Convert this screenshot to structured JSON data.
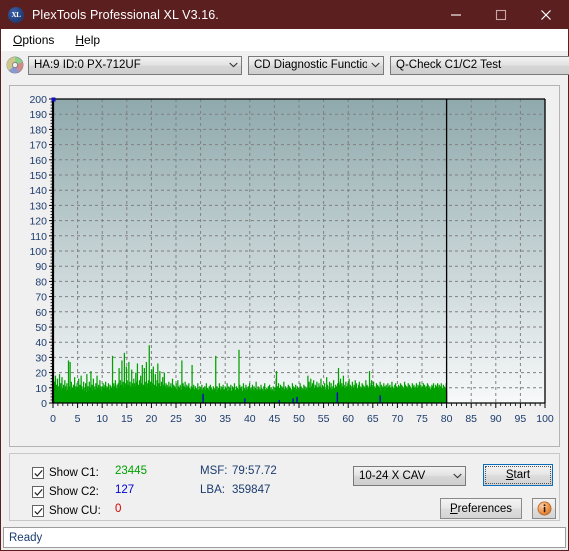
{
  "window": {
    "title": "PlexTools Professional XL V3.16.",
    "icon": "xl-app-icon",
    "icon_text": "XL",
    "titlebar_color": "#5c1f1f",
    "minimize": "minimize-icon",
    "maximize": "maximize-icon",
    "close": "close-icon"
  },
  "menu": {
    "items": [
      {
        "label": "Options",
        "mnemonic": "O"
      },
      {
        "label": "Help",
        "mnemonic": "H"
      }
    ]
  },
  "toolbar": {
    "disc_icon": "cd-disc-icon",
    "drive": {
      "value": "HA:9 ID:0  PX-712UF"
    },
    "function": {
      "value": "CD Diagnostic Functions"
    },
    "test": {
      "value": "Q-Check C1/C2 Test"
    }
  },
  "legend": {
    "c1": {
      "label": "Show C1:",
      "value": "23445",
      "color": "#00a000",
      "checked": true
    },
    "c2": {
      "label": "Show C2:",
      "value": "127",
      "color": "#0000d0",
      "checked": true
    },
    "cu": {
      "label": "Show CU:",
      "value": "0",
      "color": "#d00000",
      "checked": true
    }
  },
  "position": {
    "msf_label": "MSF:",
    "msf_value": "79:57.72",
    "lba_label": "LBA:",
    "lba_value": "359847"
  },
  "controls": {
    "speed": {
      "value": "10-24 X CAV"
    },
    "start": {
      "label": "Start",
      "mnemonic": "S",
      "focused": true
    },
    "preferences": {
      "label": "Preferences",
      "mnemonic": "P"
    },
    "info": {
      "icon": "info-icon"
    }
  },
  "statusbar": {
    "text": "Ready"
  },
  "chart_data": {
    "type": "area",
    "title": "",
    "xlabel": "",
    "ylabel": "",
    "xlim": [
      0,
      100
    ],
    "ylim": [
      0,
      200
    ],
    "xticks": [
      0,
      5,
      10,
      15,
      20,
      25,
      30,
      35,
      40,
      45,
      50,
      55,
      60,
      65,
      70,
      75,
      80,
      85,
      90,
      95,
      100
    ],
    "yticks": [
      0,
      10,
      20,
      30,
      40,
      50,
      60,
      70,
      80,
      90,
      100,
      110,
      120,
      130,
      140,
      150,
      160,
      170,
      180,
      190,
      200
    ],
    "grid": true,
    "legend_position": "below-plot",
    "plot_bg_top": "#8fa9ac",
    "plot_bg_bottom": "#f7f9fa",
    "data_end_x": 80,
    "marker": {
      "x": 0,
      "y": 200,
      "color": "#1010c0"
    },
    "series": [
      {
        "name": "C1",
        "color": "#00a000",
        "x_step": 0.08,
        "values": [
          8,
          21,
          6,
          10,
          14,
          7,
          18,
          5,
          9,
          12,
          6,
          16,
          8,
          5,
          11,
          7,
          19,
          9,
          6,
          13,
          5,
          8,
          17,
          6,
          10,
          7,
          12,
          5,
          9,
          15,
          6,
          11,
          8,
          5,
          13,
          7,
          9,
          6,
          28,
          11,
          5,
          8,
          27,
          6,
          9,
          14,
          7,
          5,
          10,
          6,
          12,
          8,
          5,
          17,
          6,
          9,
          11,
          5,
          8,
          13,
          6,
          10,
          7,
          16,
          5,
          9,
          12,
          6,
          8,
          18,
          5,
          11,
          7,
          9,
          6,
          14,
          5,
          8,
          10,
          6,
          13,
          7,
          5,
          19,
          9,
          6,
          11,
          8,
          5,
          14,
          7,
          10,
          6,
          21,
          5,
          9,
          12,
          6,
          8,
          16,
          5,
          11,
          7,
          9,
          6,
          13,
          5,
          8,
          18,
          6,
          10,
          7,
          12,
          5,
          9,
          15,
          6,
          11,
          8,
          5,
          9,
          11,
          7,
          13,
          6,
          10,
          8,
          12,
          5,
          14,
          7,
          9,
          11,
          6,
          10,
          8,
          13,
          5,
          9,
          7,
          12,
          6,
          11,
          8,
          10,
          5,
          31,
          9,
          7,
          13,
          6,
          11,
          8,
          15,
          5,
          10,
          7,
          12,
          6,
          9,
          13,
          8,
          23,
          10,
          6,
          15,
          9,
          12,
          7,
          28,
          11,
          8,
          14,
          6,
          10,
          33,
          9,
          13,
          7,
          11,
          24,
          8,
          15,
          6,
          12,
          9,
          27,
          10,
          7,
          14,
          8,
          11,
          6,
          22,
          9,
          13,
          7,
          10,
          16,
          9,
          13,
          7,
          11,
          20,
          8,
          14,
          6,
          26,
          10,
          9,
          12,
          7,
          15,
          8,
          11,
          18,
          6,
          13,
          9,
          25,
          10,
          7,
          12,
          8,
          23,
          9,
          14,
          6,
          11,
          27,
          8,
          13,
          10,
          7,
          15,
          9,
          38,
          12,
          6,
          14,
          8,
          11,
          22,
          9,
          13,
          7,
          24,
          10,
          8,
          12,
          6,
          19,
          9,
          11,
          7,
          15,
          8,
          26,
          10,
          6,
          13,
          9,
          21,
          7,
          11,
          8,
          14,
          6,
          10,
          17,
          9,
          12,
          7,
          20,
          8,
          11,
          6,
          13,
          9,
          7,
          12,
          6,
          10,
          8,
          14,
          5,
          9,
          11,
          7,
          13,
          6,
          10,
          8,
          16,
          5,
          9,
          12,
          7,
          11,
          6,
          10,
          8,
          13,
          5,
          9,
          7,
          15,
          6,
          11,
          8,
          10,
          5,
          12,
          7,
          9,
          6,
          28,
          10,
          8,
          13,
          7,
          11,
          6,
          9,
          14,
          8,
          10,
          5,
          12,
          7,
          9,
          11,
          6,
          13,
          8,
          10,
          7,
          9,
          6,
          11,
          5,
          25,
          8,
          10,
          7,
          12,
          6,
          9,
          8,
          11,
          5,
          10,
          7,
          9,
          6,
          13,
          8,
          5,
          9,
          7,
          11,
          6,
          10,
          8,
          5,
          12,
          7,
          9,
          6,
          10,
          8,
          5,
          11,
          7,
          9,
          6,
          13,
          8,
          5,
          10,
          7,
          9,
          6,
          11,
          8,
          5,
          12,
          7,
          10,
          6,
          9,
          8,
          5,
          11,
          7,
          10,
          6,
          9,
          8,
          31,
          7,
          5,
          11,
          6,
          9,
          8,
          10,
          5,
          13,
          7,
          9,
          6,
          11,
          8,
          5,
          10,
          7,
          12,
          6,
          9,
          8,
          5,
          11,
          7,
          10,
          6,
          9,
          13,
          5,
          8,
          7,
          11,
          6,
          9,
          10,
          5,
          12,
          7,
          8,
          6,
          11,
          9,
          5,
          10,
          7,
          13,
          6,
          8,
          9,
          5,
          11,
          7,
          10,
          6,
          9,
          8,
          35,
          5,
          12,
          7,
          10,
          6,
          9,
          11,
          5,
          8,
          7,
          13,
          6,
          10,
          9,
          5,
          8,
          12,
          6,
          10,
          7,
          9,
          5,
          11,
          8,
          6,
          13,
          7,
          9,
          5,
          10,
          8,
          6,
          12,
          7,
          9,
          5,
          11,
          8,
          6,
          10,
          7,
          14,
          5,
          9,
          8,
          6,
          11,
          7,
          10,
          5,
          9,
          8,
          6,
          12,
          7,
          10,
          5,
          9,
          8,
          6,
          11,
          7,
          13,
          5,
          9,
          8,
          6,
          10,
          7,
          9,
          5,
          11,
          8,
          6,
          12,
          7,
          9,
          5,
          10,
          8,
          6,
          9,
          7,
          11,
          5,
          8,
          6,
          10,
          7,
          9,
          16,
          21,
          7,
          11,
          6,
          9,
          13,
          5,
          10,
          8,
          7,
          12,
          6,
          9,
          11,
          5,
          8,
          10,
          6,
          14,
          7,
          9,
          5,
          11,
          8,
          6,
          10,
          7,
          9,
          5,
          12,
          8,
          6,
          11,
          7,
          10,
          5,
          9,
          8,
          6,
          13,
          7,
          11,
          5,
          9,
          10,
          6,
          8,
          12,
          7,
          9,
          5,
          11,
          6,
          10,
          8,
          7,
          9,
          5,
          13,
          6,
          11,
          8,
          7,
          10,
          5,
          9,
          6,
          12,
          8,
          7,
          11,
          5,
          9,
          6,
          10,
          8,
          7,
          18,
          12,
          8,
          14,
          6,
          10,
          9,
          16,
          7,
          11,
          8,
          13,
          6,
          9,
          15,
          7,
          10,
          8,
          12,
          6,
          11,
          9,
          14,
          7,
          8,
          10,
          6,
          13,
          9,
          7,
          11,
          8,
          16,
          6,
          10,
          7,
          12,
          9,
          6,
          11,
          8,
          13,
          7,
          9,
          6,
          10,
          17,
          8,
          12,
          7,
          9,
          6,
          11,
          14,
          8,
          10,
          7,
          13,
          6,
          9,
          8,
          11,
          7,
          15,
          6,
          10,
          9,
          8,
          12,
          7,
          11,
          6,
          9,
          13,
          8,
          23,
          14,
          9,
          12,
          7,
          16,
          10,
          8,
          13,
          6,
          11,
          9,
          18,
          7,
          12,
          8,
          10,
          6,
          14,
          9,
          7,
          11,
          8,
          13,
          6,
          10,
          16,
          9,
          7,
          12,
          8,
          11,
          6,
          9,
          14,
          7,
          10,
          8,
          12,
          9,
          6,
          15,
          11,
          8,
          13,
          7,
          10,
          9,
          6,
          12,
          8,
          14,
          7,
          11,
          6,
          9,
          10,
          8,
          13,
          7,
          12,
          6,
          9,
          11,
          8,
          10,
          7,
          15,
          6,
          9,
          12,
          8,
          11,
          7,
          10,
          6,
          21,
          13,
          9,
          11,
          7,
          15,
          10,
          8,
          12,
          6,
          14,
          9,
          7,
          11,
          8,
          10,
          6,
          13,
          9,
          7,
          12,
          8,
          11,
          6,
          10,
          9,
          14,
          7,
          8,
          12,
          6,
          11,
          9,
          10,
          7,
          13,
          8,
          6,
          11,
          9,
          7,
          12,
          8,
          10,
          6,
          13,
          9,
          7,
          11,
          8,
          12,
          6,
          10,
          9,
          7,
          14,
          8,
          11,
          6,
          9,
          10,
          7,
          12,
          8,
          13,
          6,
          11,
          9,
          7,
          10,
          8,
          12,
          6,
          9,
          11,
          7,
          13,
          10,
          8,
          12,
          6,
          11,
          9,
          7,
          10,
          8,
          14,
          6,
          12,
          9,
          7,
          11,
          8,
          10,
          6,
          13,
          9,
          7,
          12,
          8,
          11,
          6,
          10,
          9,
          8,
          13,
          7,
          11,
          6,
          12,
          9,
          10,
          8,
          7,
          11,
          13,
          9,
          10,
          8,
          12,
          7,
          11,
          6,
          14,
          9,
          8,
          12,
          7,
          10,
          6,
          11,
          9,
          13,
          8,
          7,
          12,
          6,
          10,
          9,
          11,
          8,
          7,
          13,
          6,
          12,
          9,
          10,
          8,
          11,
          7,
          6,
          9,
          10,
          12,
          8,
          11,
          7,
          13,
          9,
          6,
          10,
          8,
          12,
          7,
          11,
          9,
          6,
          13,
          8,
          10,
          7,
          12,
          9,
          6,
          11,
          8,
          13,
          7,
          10,
          9,
          6,
          12,
          8,
          11,
          7,
          9,
          10,
          6,
          13,
          8
        ]
      },
      {
        "name": "C2",
        "color": "#0000d0",
        "description": "sparse narrow spikes",
        "points": [
          {
            "x": 30.5,
            "y": 6
          },
          {
            "x": 39.0,
            "y": 3
          },
          {
            "x": 46.0,
            "y": 2
          },
          {
            "x": 48.8,
            "y": 3
          },
          {
            "x": 49.6,
            "y": 4
          },
          {
            "x": 57.8,
            "y": 7
          },
          {
            "x": 66.5,
            "y": 5
          }
        ]
      },
      {
        "name": "CU",
        "color": "#d00000",
        "points": []
      }
    ]
  }
}
